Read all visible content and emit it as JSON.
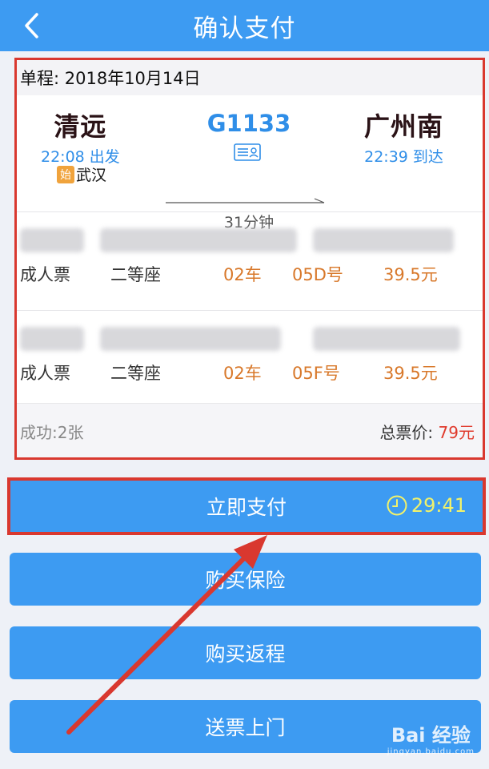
{
  "header": {
    "title": "确认支付"
  },
  "trip": {
    "date_line": "单程: 2018年10月14日",
    "from": {
      "name": "清远",
      "time": "22:08 出发"
    },
    "to": {
      "name": "广州南",
      "time": "22:39 到达"
    },
    "origin": {
      "badge": "始",
      "station": "武汉"
    },
    "train_no": "G1133",
    "duration": "31分钟"
  },
  "passengers": [
    {
      "type": "成人票",
      "seat_class": "二等座",
      "car": "02车",
      "seat": "05D号",
      "price": "39.5元"
    },
    {
      "type": "成人票",
      "seat_class": "二等座",
      "car": "02车",
      "seat": "05F号",
      "price": "39.5元"
    }
  ],
  "summary": {
    "success": "成功:2张",
    "total_label": "总票价: ",
    "total_amount": "79元"
  },
  "buttons": {
    "pay": "立即支付",
    "countdown": "29:41",
    "insurance": "购买保险",
    "return_trip": "购买返程",
    "delivery": "送票上门"
  },
  "watermark": {
    "brand": "Bai 经验",
    "url": "jingyan.baidu.com"
  },
  "colors": {
    "primary": "#3d9bf2",
    "accent_orange": "#d8782a",
    "price_red": "#e03a2c",
    "annotation_red": "#d9382f"
  }
}
